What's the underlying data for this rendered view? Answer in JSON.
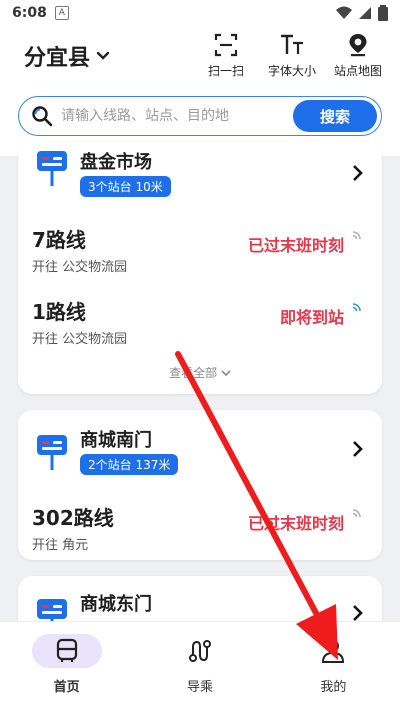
{
  "status": {
    "time": "6:08",
    "a_label": "A"
  },
  "header": {
    "city": "分宜县",
    "tools": [
      {
        "label": "扫一扫",
        "icon": "scan-icon"
      },
      {
        "label": "字体大小",
        "icon": "font-size-icon"
      },
      {
        "label": "站点地图",
        "icon": "map-pin-icon"
      }
    ]
  },
  "search": {
    "placeholder": "请输入线路、站点、目的地",
    "button": "搜索"
  },
  "cards": [
    {
      "name": "盘金市场",
      "badge": "3个站台 10米",
      "routes": [
        {
          "name": "7路线",
          "dir": "开往 公交物流园",
          "status": "已过末班时刻"
        },
        {
          "name": "1路线",
          "dir": "开往 公交物流园",
          "status": "即将到站"
        }
      ],
      "see_all": "查看全部"
    },
    {
      "name": "商城南门",
      "badge": "2个站台 137米",
      "routes": [
        {
          "name": "302路线",
          "dir": "开往 角元",
          "status": "已过末班时刻"
        }
      ]
    },
    {
      "name": "商城东门"
    }
  ],
  "nav": [
    {
      "label": "首页",
      "icon": "bus-icon",
      "active": true
    },
    {
      "label": "导乘",
      "icon": "route-icon",
      "active": false
    },
    {
      "label": "我的",
      "icon": "user-icon",
      "active": false
    }
  ],
  "colors": {
    "accent": "#1f6feb",
    "alert": "#e8364a",
    "annotation_arrow": "#ee1c1c"
  }
}
